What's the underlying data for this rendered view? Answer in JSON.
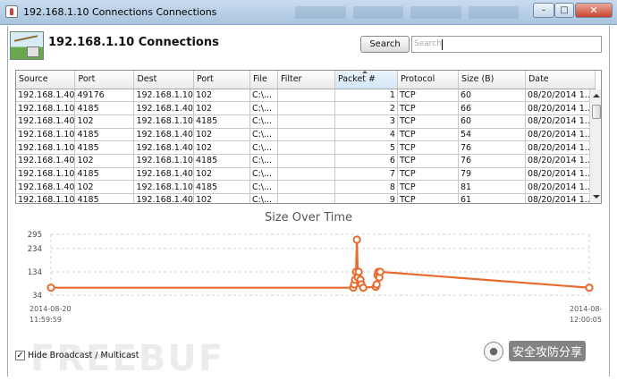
{
  "window": {
    "title": "192.168.1.10 Connections Connections",
    "minimize_icon": "minimize-icon",
    "maximize_icon": "maximize-icon",
    "close_icon": "close-icon"
  },
  "header": {
    "heading": "192.168.1.10 Connections",
    "search_button": "Search",
    "search_placeholder": "Search"
  },
  "table": {
    "columns": [
      "Source",
      "Port",
      "Dest",
      "Port",
      "File",
      "Filter",
      "Packet #",
      "Protocol",
      "Size (B)",
      "Date"
    ],
    "sorted_column": "Packet #",
    "rows": [
      [
        "192.168.1.40",
        "49176",
        "192.168.1.10",
        "102",
        "C:\\...",
        "",
        "1",
        "TCP",
        "60",
        "08/20/2014 1..."
      ],
      [
        "192.168.1.10",
        "4185",
        "192.168.1.40",
        "102",
        "C:\\...",
        "",
        "2",
        "TCP",
        "66",
        "08/20/2014 1..."
      ],
      [
        "192.168.1.40",
        "102",
        "192.168.1.10",
        "4185",
        "C:\\...",
        "",
        "3",
        "TCP",
        "60",
        "08/20/2014 1..."
      ],
      [
        "192.168.1.10",
        "4185",
        "192.168.1.40",
        "102",
        "C:\\...",
        "",
        "4",
        "TCP",
        "54",
        "08/20/2014 1..."
      ],
      [
        "192.168.1.10",
        "4185",
        "192.168.1.40",
        "102",
        "C:\\...",
        "",
        "5",
        "TCP",
        "76",
        "08/20/2014 1..."
      ],
      [
        "192.168.1.40",
        "102",
        "192.168.1.10",
        "4185",
        "C:\\...",
        "",
        "6",
        "TCP",
        "76",
        "08/20/2014 1..."
      ],
      [
        "192.168.1.10",
        "4185",
        "192.168.1.40",
        "102",
        "C:\\...",
        "",
        "7",
        "TCP",
        "79",
        "08/20/2014 1..."
      ],
      [
        "192.168.1.40",
        "102",
        "192.168.1.10",
        "4185",
        "C:\\...",
        "",
        "8",
        "TCP",
        "81",
        "08/20/2014 1..."
      ],
      [
        "192.168.1.10",
        "4185",
        "192.168.1.40",
        "102",
        "C:\\...",
        "",
        "9",
        "TCP",
        "61",
        "08/20/2014 1..."
      ]
    ]
  },
  "chart_data": {
    "type": "line",
    "title": "Size Over Time",
    "xlabel": "",
    "ylabel": "",
    "x_tick_labels": [
      {
        "date": "2014-08-20",
        "time": "11:59:59"
      },
      {
        "date": "2014-08-",
        "time": "12:00:05"
      }
    ],
    "y_ticks": [
      34,
      134,
      234,
      295
    ],
    "ylim": [
      34,
      295
    ],
    "grid": true,
    "color": "#e86a2c",
    "series": [
      {
        "values": [
          [
            0.0,
            66
          ],
          [
            3.37,
            66
          ],
          [
            3.38,
            80
          ],
          [
            3.39,
            100
          ],
          [
            3.4,
            134
          ],
          [
            3.41,
            272
          ],
          [
            3.42,
            110
          ],
          [
            3.43,
            134
          ],
          [
            3.45,
            100
          ],
          [
            3.46,
            80
          ],
          [
            3.48,
            66
          ],
          [
            3.62,
            70
          ],
          [
            3.63,
            80
          ],
          [
            3.64,
            120
          ],
          [
            3.65,
            134
          ],
          [
            3.66,
            110
          ],
          [
            3.67,
            134
          ],
          [
            6.0,
            66
          ]
        ]
      }
    ]
  },
  "footer": {
    "checkbox_checked": true,
    "checkbox_label": "Hide Broadcast / Multicast",
    "watermark_left": "FREEBUF",
    "watermark_right": "安全攻防分享"
  }
}
